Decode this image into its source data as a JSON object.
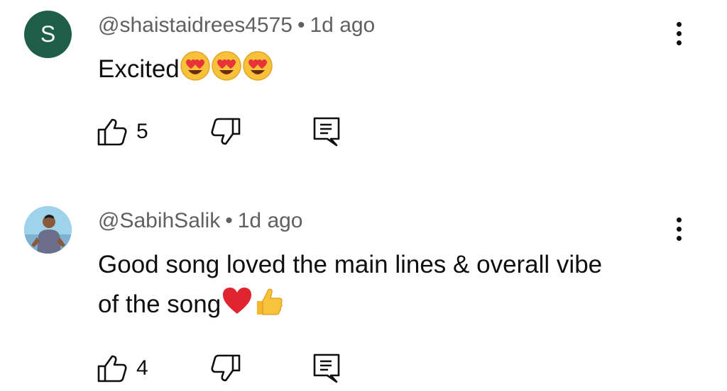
{
  "comments": [
    {
      "avatar_letter": "S",
      "author": "@shaistaidrees4575",
      "separator": "•",
      "time": "1d ago",
      "text": "Excited",
      "emojis": [
        "heart-eyes-emoji",
        "heart-eyes-emoji",
        "heart-eyes-emoji"
      ],
      "likes": "5"
    },
    {
      "avatar": "profile-photo",
      "author": "@SabihSalik",
      "separator": "•",
      "time": "1d ago",
      "text_line1": "Good song loved the main lines & overall vibe",
      "text_line2": "of the song",
      "emojis": [
        "red-heart-emoji",
        "thumbs-up-emoji"
      ],
      "likes": "4"
    }
  ],
  "icons": {
    "like": "thumb-up-outline-icon",
    "dislike": "thumb-down-outline-icon",
    "reply": "reply-comment-icon",
    "more": "more-vertical-icon"
  },
  "colors": {
    "avatar_bg": "#1f5e49",
    "meta_text": "#606060",
    "body_text": "#0f0f0f"
  }
}
